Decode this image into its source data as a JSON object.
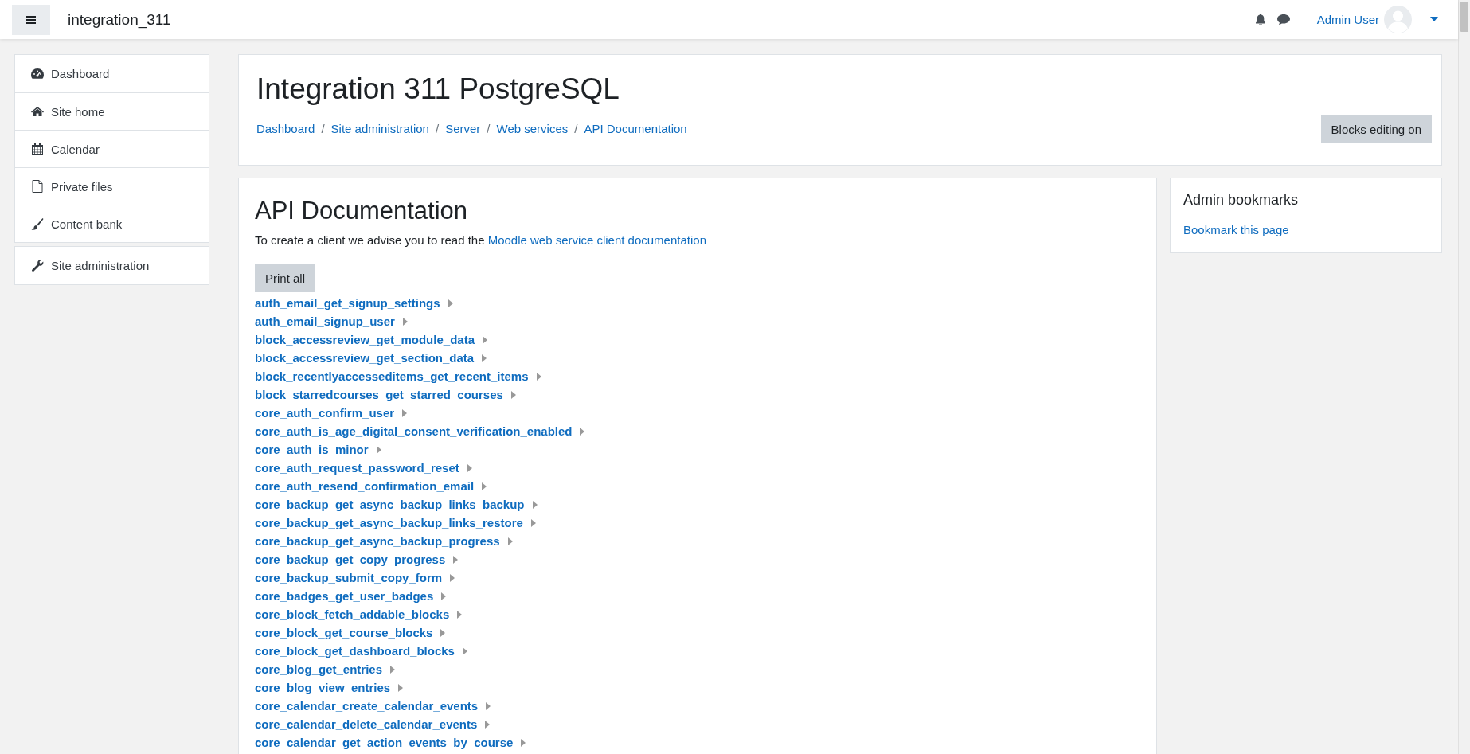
{
  "navbar": {
    "site_name": "integration_311",
    "user_name": "Admin User"
  },
  "sidebar": {
    "groups": [
      [
        {
          "label": "Dashboard"
        },
        {
          "label": "Site home"
        },
        {
          "label": "Calendar"
        },
        {
          "label": "Private files"
        },
        {
          "label": "Content bank"
        }
      ],
      [
        {
          "label": "Site administration"
        }
      ]
    ]
  },
  "header": {
    "title": "Integration 311 PostgreSQL",
    "breadcrumbs": [
      "Dashboard",
      "Site administration",
      "Server",
      "Web services",
      "API Documentation"
    ],
    "separator": "/",
    "button": "Blocks editing on"
  },
  "main": {
    "title": "API Documentation",
    "intro": "To create a client we advise you to read the",
    "intro_link": "Moodle web service client documentation",
    "print_button": "Print all",
    "functions": [
      "auth_email_get_signup_settings",
      "auth_email_signup_user",
      "block_accessreview_get_module_data",
      "block_accessreview_get_section_data",
      "block_recentlyaccesseditems_get_recent_items",
      "block_starredcourses_get_starred_courses",
      "core_auth_confirm_user",
      "core_auth_is_age_digital_consent_verification_enabled",
      "core_auth_is_minor",
      "core_auth_request_password_reset",
      "core_auth_resend_confirmation_email",
      "core_backup_get_async_backup_links_backup",
      "core_backup_get_async_backup_links_restore",
      "core_backup_get_async_backup_progress",
      "core_backup_get_copy_progress",
      "core_backup_submit_copy_form",
      "core_badges_get_user_badges",
      "core_block_fetch_addable_blocks",
      "core_block_get_course_blocks",
      "core_block_get_dashboard_blocks",
      "core_blog_get_entries",
      "core_blog_view_entries",
      "core_calendar_create_calendar_events",
      "core_calendar_delete_calendar_events",
      "core_calendar_get_action_events_by_course"
    ]
  },
  "bookmarks": {
    "title": "Admin bookmarks",
    "link": "Bookmark this page"
  }
}
